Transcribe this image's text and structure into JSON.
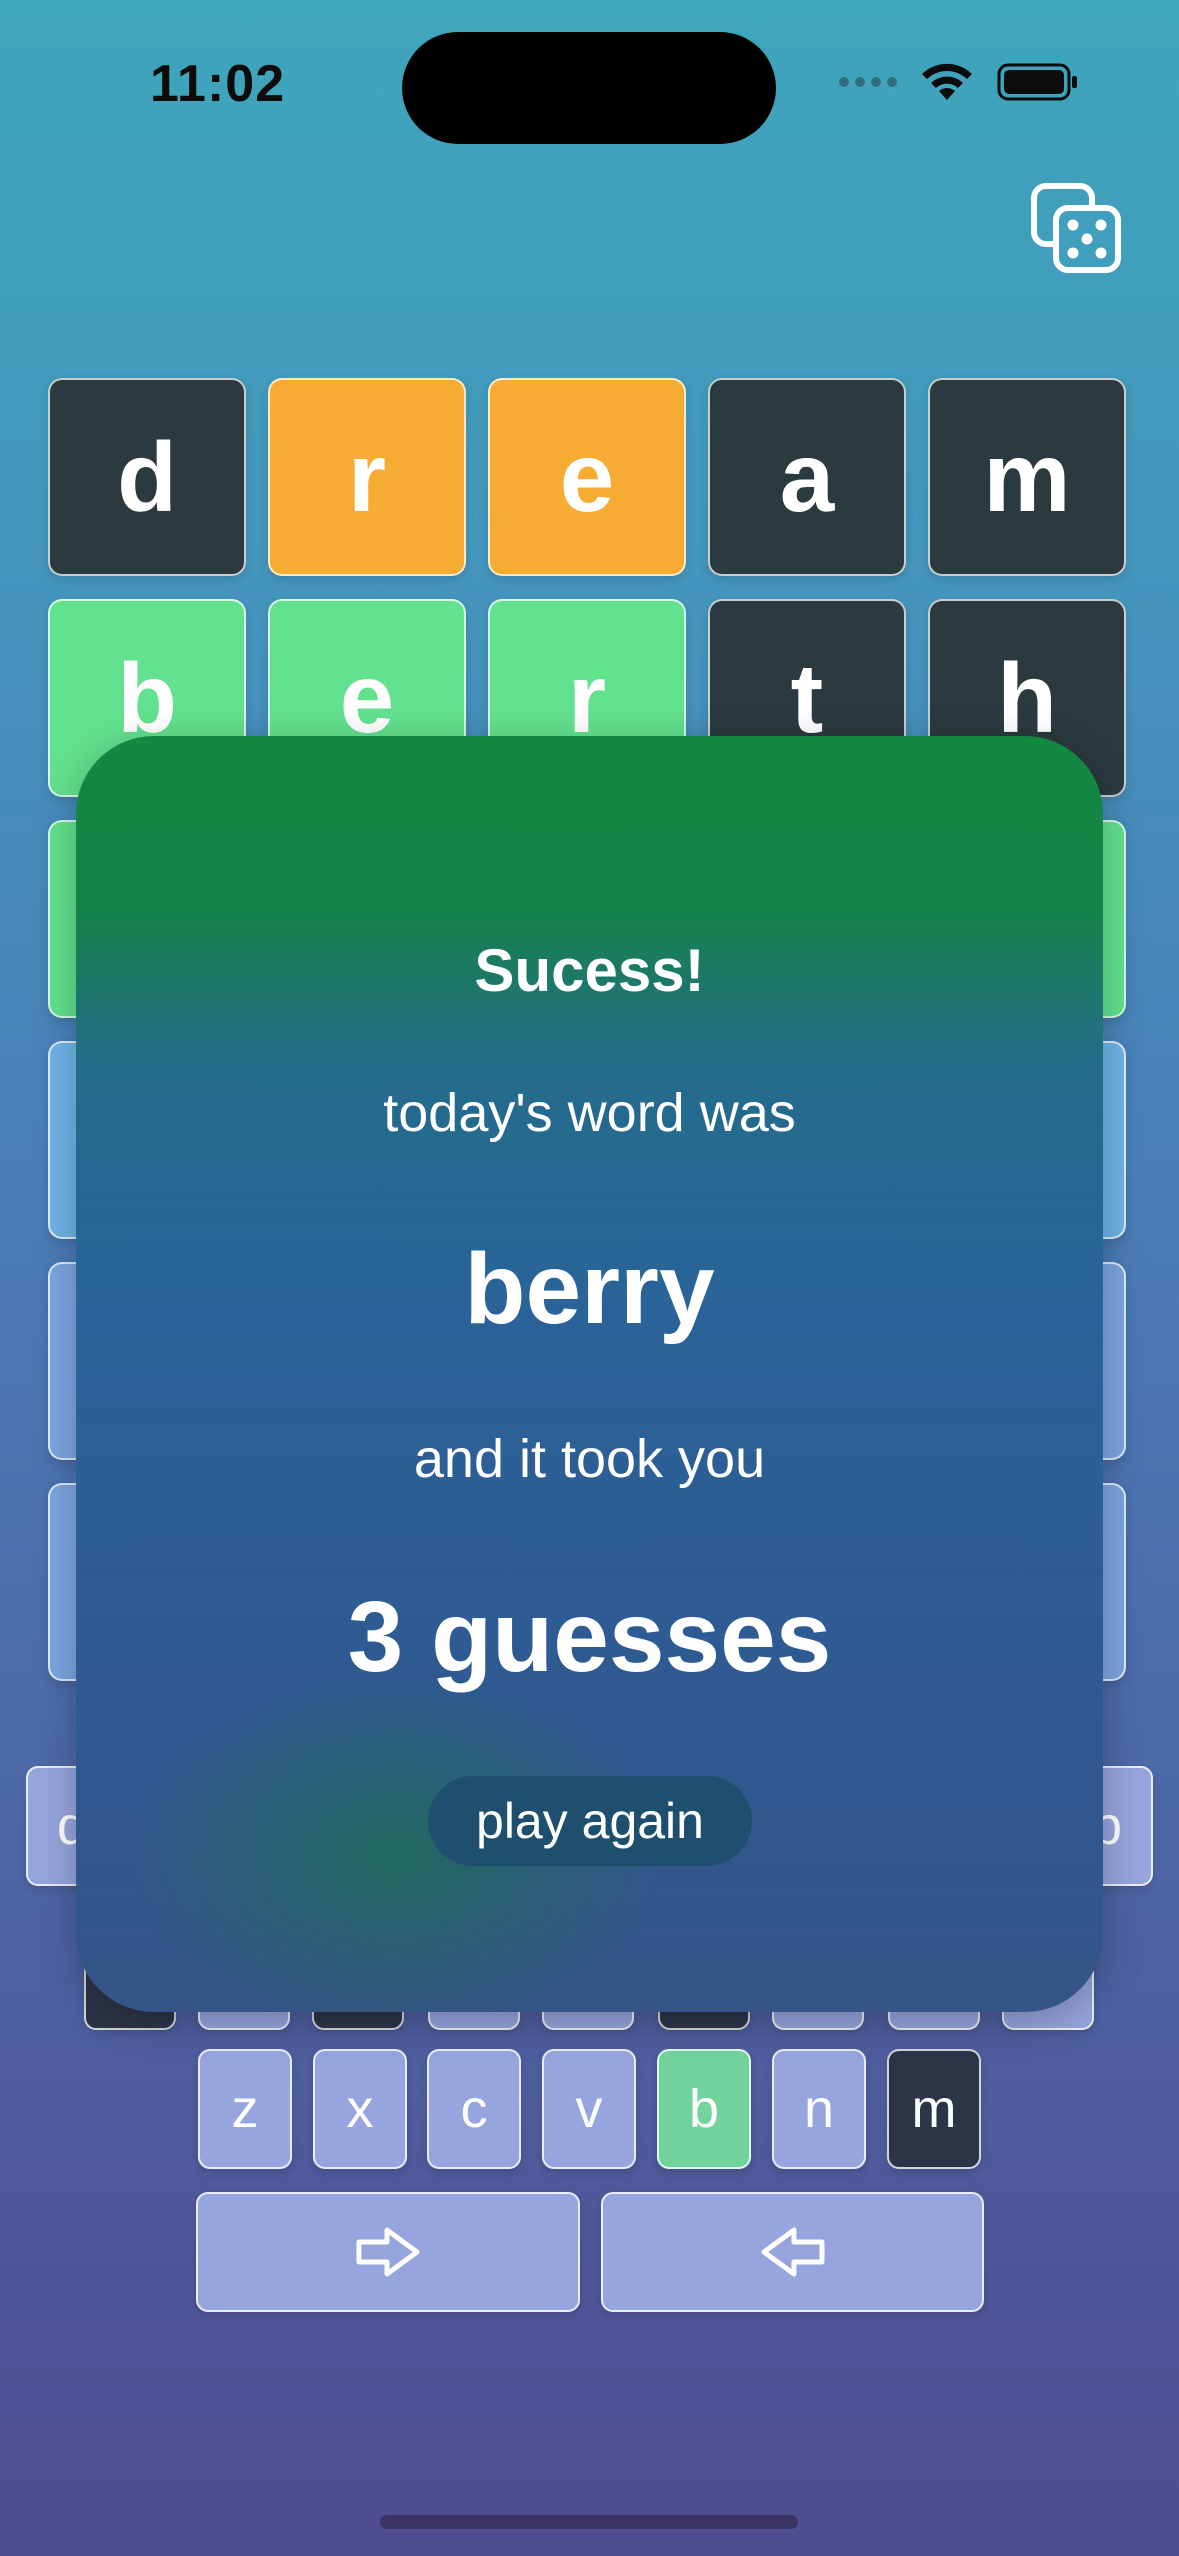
{
  "status": {
    "time": "11:02"
  },
  "icons": {
    "dice": "dice-icon",
    "wifi": "wifi-icon",
    "battery": "battery-icon",
    "next": "arrow-right-icon",
    "back": "arrow-left-icon"
  },
  "colors": {
    "absent": "#2b3a3f",
    "present": "#f6ab33",
    "correct": "#62e18e",
    "key": "#96a5dd"
  },
  "grid": {
    "rows": [
      [
        {
          "l": "d",
          "s": "absent"
        },
        {
          "l": "r",
          "s": "present"
        },
        {
          "l": "e",
          "s": "present"
        },
        {
          "l": "a",
          "s": "absent"
        },
        {
          "l": "m",
          "s": "absent"
        }
      ],
      [
        {
          "l": "b",
          "s": "correct"
        },
        {
          "l": "e",
          "s": "correct"
        },
        {
          "l": "r",
          "s": "correct"
        },
        {
          "l": "t",
          "s": "absent"
        },
        {
          "l": "h",
          "s": "absent"
        }
      ],
      [
        {
          "l": "",
          "s": "correct"
        },
        {
          "l": "",
          "s": "correct"
        },
        {
          "l": "",
          "s": "correct"
        },
        {
          "l": "",
          "s": "correct"
        },
        {
          "l": "",
          "s": "correct"
        }
      ],
      [
        {
          "l": "",
          "s": "empty"
        },
        {
          "l": "",
          "s": "empty"
        },
        {
          "l": "",
          "s": "empty"
        },
        {
          "l": "",
          "s": "empty"
        },
        {
          "l": "",
          "s": "empty"
        }
      ],
      [
        {
          "l": "",
          "s": "empty2"
        },
        {
          "l": "",
          "s": "empty2"
        },
        {
          "l": "",
          "s": "empty2"
        },
        {
          "l": "",
          "s": "empty2"
        },
        {
          "l": "",
          "s": "empty2"
        }
      ],
      [
        {
          "l": "",
          "s": "empty2"
        },
        {
          "l": "",
          "s": "empty2"
        },
        {
          "l": "",
          "s": "empty2"
        },
        {
          "l": "",
          "s": "empty2"
        },
        {
          "l": "",
          "s": "empty2"
        }
      ]
    ]
  },
  "keyboard": {
    "row1_edges": {
      "left": "q",
      "right": "p"
    },
    "row3": [
      {
        "k": "z",
        "s": "key"
      },
      {
        "k": "x",
        "s": "key"
      },
      {
        "k": "c",
        "s": "key"
      },
      {
        "k": "v",
        "s": "key"
      },
      {
        "k": "b",
        "s": "correct"
      },
      {
        "k": "n",
        "s": "key"
      },
      {
        "k": "m",
        "s": "absent"
      }
    ]
  },
  "dialog": {
    "title": "Sucess!",
    "line1": "today's word was",
    "word": "berry",
    "line2": "and it took you",
    "guesses": "3 guesses",
    "play_again": "play again"
  }
}
